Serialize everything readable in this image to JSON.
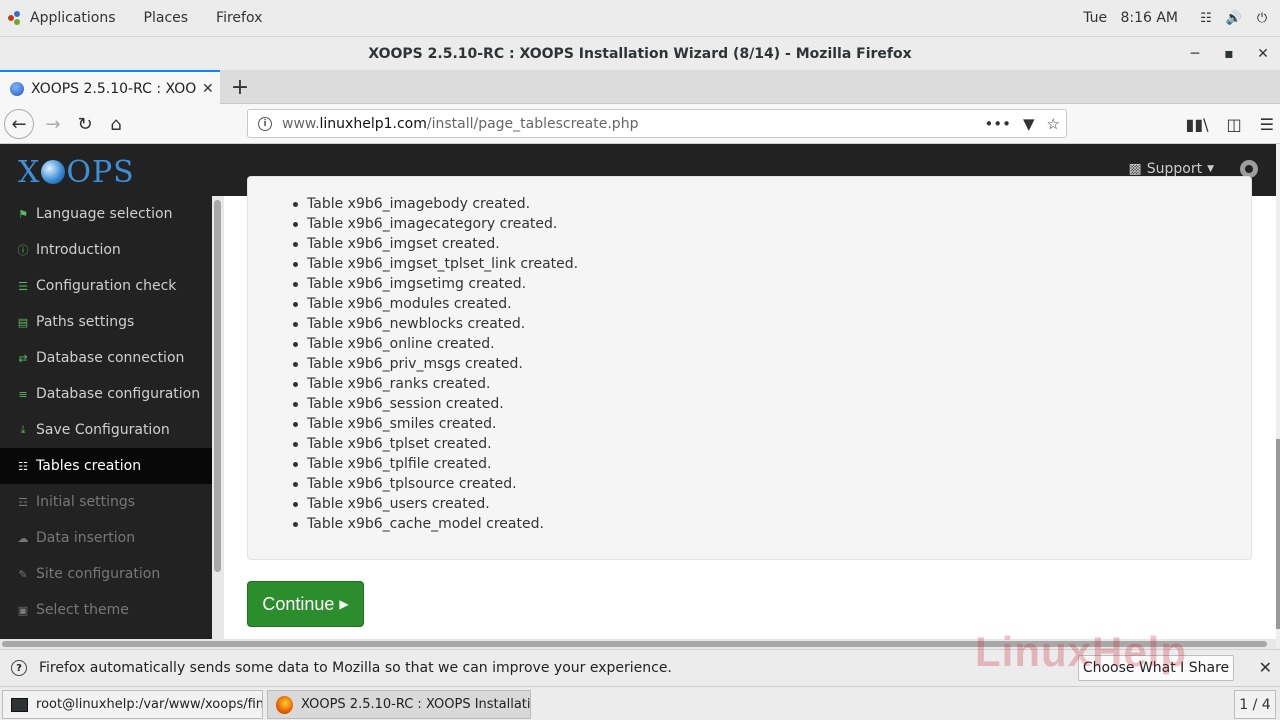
{
  "gnome": {
    "applications": "Applications",
    "places": "Places",
    "firefox": "Firefox",
    "clock": "Tue   8:16 AM"
  },
  "window": {
    "title": "XOOPS 2.5.10-RC : XOOPS Installation Wizard (8/14) - Mozilla Firefox"
  },
  "tab": {
    "title": "XOOPS 2.5.10-RC : XOOPS Installation Wizard (8/14)"
  },
  "url": {
    "prefix": "www.",
    "domain": "linuxhelp1.com",
    "path": "/install/page_tablescreate.php"
  },
  "xoops": {
    "logo_left": "X",
    "logo_right": "OPS",
    "support": "Support"
  },
  "sidebar": {
    "items": [
      {
        "label": "Language selection",
        "icon": "flag-icon",
        "state": "done"
      },
      {
        "label": "Introduction",
        "icon": "info-icon",
        "state": "done"
      },
      {
        "label": "Configuration check",
        "icon": "list-icon",
        "state": "done"
      },
      {
        "label": "Paths settings",
        "icon": "folder-icon",
        "state": "done"
      },
      {
        "label": "Database connection",
        "icon": "exchange-icon",
        "state": "done"
      },
      {
        "label": "Database configuration",
        "icon": "database-icon",
        "state": "done"
      },
      {
        "label": "Save Configuration",
        "icon": "download-icon",
        "state": "done"
      },
      {
        "label": "Tables creation",
        "icon": "sitemap-icon",
        "state": "active"
      },
      {
        "label": "Initial settings",
        "icon": "sliders-icon",
        "state": "disabled"
      },
      {
        "label": "Data insertion",
        "icon": "cloud-upload-icon",
        "state": "disabled"
      },
      {
        "label": "Site configuration",
        "icon": "edit-icon",
        "state": "disabled"
      },
      {
        "label": "Select theme",
        "icon": "picture-icon",
        "state": "disabled"
      }
    ]
  },
  "tables": [
    "Table x9b6_imagebody created.",
    "Table x9b6_imagecategory created.",
    "Table x9b6_imgset created.",
    "Table x9b6_imgset_tplset_link created.",
    "Table x9b6_imgsetimg created.",
    "Table x9b6_modules created.",
    "Table x9b6_newblocks created.",
    "Table x9b6_online created.",
    "Table x9b6_priv_msgs created.",
    "Table x9b6_ranks created.",
    "Table x9b6_session created.",
    "Table x9b6_smiles created.",
    "Table x9b6_tplset created.",
    "Table x9b6_tplfile created.",
    "Table x9b6_tplsource created.",
    "Table x9b6_users created.",
    "Table x9b6_cache_model created."
  ],
  "continue_label": "Continue",
  "notification": {
    "text": "Firefox automatically sends some data to Mozilla so that we can improve your experience.",
    "button": "Choose What I Share"
  },
  "watermark": "LinuxHelp",
  "taskbar": {
    "terminal": "root@linuxhelp:/var/www/xoops/fin...",
    "firefox": "XOOPS 2.5.10-RC : XOOPS Installati...",
    "workspace": "1 / 4"
  },
  "colors": {
    "accent": "#0a84ff",
    "continue_green": "#2b8d2b",
    "header_bg": "#222222",
    "logo_blue": "#3c8fd8",
    "done_icon": "#5cb85c"
  }
}
